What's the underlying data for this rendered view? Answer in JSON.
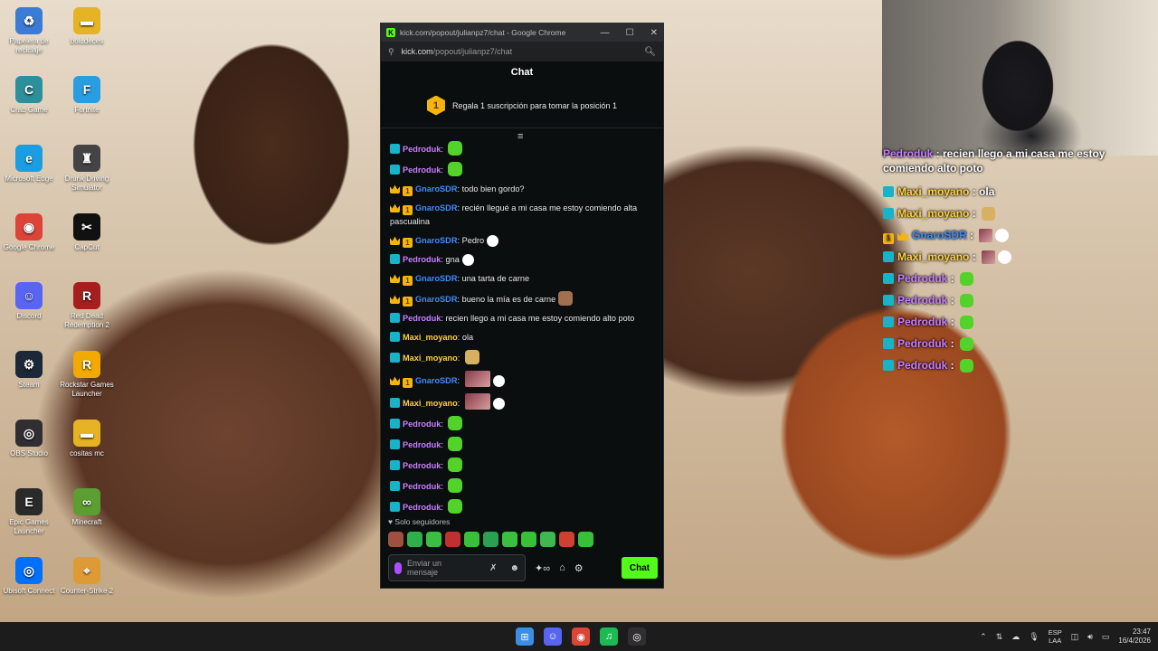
{
  "desktop_icons": [
    {
      "label": "Papelera de reciclaje",
      "icon": "recycle-bin-icon",
      "color": "#3a7bd5",
      "glyph": "♻"
    },
    {
      "label": "boludeces",
      "icon": "folder-icon",
      "color": "#e6b325",
      "glyph": "▬"
    },
    {
      "label": "Crab Game",
      "icon": "crab-game-icon",
      "color": "#2c8f9c",
      "glyph": "C"
    },
    {
      "label": "Fortnite",
      "icon": "fortnite-icon",
      "color": "#2a9de0",
      "glyph": "F"
    },
    {
      "label": "Microsoft Edge",
      "icon": "edge-icon",
      "color": "#1b9de2",
      "glyph": "e"
    },
    {
      "label": "Drunk Driving Simulator",
      "icon": "drunk-driving-icon",
      "color": "#444444",
      "glyph": "♜"
    },
    {
      "label": "Google Chrome",
      "icon": "chrome-icon",
      "color": "#db4437",
      "glyph": "◉"
    },
    {
      "label": "CapCut",
      "icon": "capcut-icon",
      "color": "#111111",
      "glyph": "✂"
    },
    {
      "label": "Discord",
      "icon": "discord-icon",
      "color": "#5865f2",
      "glyph": "☺"
    },
    {
      "label": "Red Dead Redemption 2",
      "icon": "rdr2-icon",
      "color": "#a51f1f",
      "glyph": "R"
    },
    {
      "label": "Steam",
      "icon": "steam-icon",
      "color": "#1b2838",
      "glyph": "⚙"
    },
    {
      "label": "Rockstar Games Launcher",
      "icon": "rockstar-icon",
      "color": "#f2a900",
      "glyph": "R"
    },
    {
      "label": "OBS Studio",
      "icon": "obs-icon",
      "color": "#302e31",
      "glyph": "◎"
    },
    {
      "label": "cositas mc",
      "icon": "folder-icon",
      "color": "#e6b325",
      "glyph": "▬"
    },
    {
      "label": "Epic Games Launcher",
      "icon": "epic-games-icon",
      "color": "#2a2a2a",
      "glyph": "E"
    },
    {
      "label": "Minecraft",
      "icon": "minecraft-icon",
      "color": "#5c9e31",
      "glyph": "∞"
    },
    {
      "label": "Ubisoft Connect",
      "icon": "ubisoft-icon",
      "color": "#0070ff",
      "glyph": "◎"
    },
    {
      "label": "Counter-Strike 2",
      "icon": "cs2-icon",
      "color": "#de9b35",
      "glyph": "⌖"
    }
  ],
  "window": {
    "title": "kick.com/popout/julianpz7/chat - Google Chrome",
    "url_domain": "kick.com",
    "url_path": "/popout/julianpz7/chat",
    "minimize": "—",
    "maximize": "☐",
    "close": "✕"
  },
  "chat": {
    "header": "Chat",
    "sub_banner_number": "1",
    "sub_banner_text": "Regala 1 suscripción para tomar la posición 1",
    "followers_only": "Solo seguidores",
    "input_placeholder": "Enviar un mensaje",
    "send_label": "Chat",
    "messages": [
      {
        "user": "Pedroduk",
        "cls": "u-ped",
        "badges": [
          "sub"
        ],
        "text": "",
        "emotes": [
          "green"
        ]
      },
      {
        "user": "Pedroduk",
        "cls": "u-ped",
        "badges": [
          "sub"
        ],
        "text": "",
        "emotes": [
          "green"
        ]
      },
      {
        "user": "GnaroSDR",
        "cls": "u-gna",
        "badges": [
          "crown",
          "gift"
        ],
        "text": "todo bien gordo?",
        "emotes": []
      },
      {
        "user": "GnaroSDR",
        "cls": "u-gna",
        "badges": [
          "crown",
          "gift"
        ],
        "text": "recién llegué a mi casa me estoy comiendo alta pascualina",
        "emotes": []
      },
      {
        "user": "GnaroSDR",
        "cls": "u-gna",
        "badges": [
          "crown",
          "gift"
        ],
        "text": "Pedro",
        "emotes": [
          "cat"
        ]
      },
      {
        "user": "Pedroduk",
        "cls": "u-ped",
        "badges": [
          "sub"
        ],
        "text": "gna",
        "emotes": [
          "cat"
        ]
      },
      {
        "user": "GnaroSDR",
        "cls": "u-gna",
        "badges": [
          "crown",
          "gift"
        ],
        "text": "una tarta de carne",
        "emotes": []
      },
      {
        "user": "GnaroSDR",
        "cls": "u-gna",
        "badges": [
          "crown",
          "gift"
        ],
        "text": "bueno la mía es de carne",
        "emotes": [
          "face"
        ]
      },
      {
        "user": "Pedroduk",
        "cls": "u-ped",
        "badges": [
          "sub"
        ],
        "text": "recien llego a mi casa me estoy comiendo alto poto",
        "emotes": []
      },
      {
        "user": "Maxi_moyano",
        "cls": "u-max",
        "badges": [
          "sub"
        ],
        "text": "ola",
        "emotes": []
      },
      {
        "user": "Maxi_moyano",
        "cls": "u-max",
        "badges": [
          "sub"
        ],
        "text": "",
        "emotes": [
          "dog"
        ]
      },
      {
        "user": "GnaroSDR",
        "cls": "u-gna",
        "badges": [
          "crown",
          "gift"
        ],
        "text": "",
        "emotes": [
          "img",
          "cat"
        ]
      },
      {
        "user": "Maxi_moyano",
        "cls": "u-max",
        "badges": [
          "sub"
        ],
        "text": "",
        "emotes": [
          "img",
          "cat"
        ]
      },
      {
        "user": "Pedroduk",
        "cls": "u-ped",
        "badges": [
          "sub"
        ],
        "text": "",
        "emotes": [
          "green"
        ]
      },
      {
        "user": "Pedroduk",
        "cls": "u-ped",
        "badges": [
          "sub"
        ],
        "text": "",
        "emotes": [
          "green"
        ]
      },
      {
        "user": "Pedroduk",
        "cls": "u-ped",
        "badges": [
          "sub"
        ],
        "text": "",
        "emotes": [
          "green"
        ]
      },
      {
        "user": "Pedroduk",
        "cls": "u-ped",
        "badges": [
          "sub"
        ],
        "text": "",
        "emotes": [
          "green"
        ]
      },
      {
        "user": "Pedroduk",
        "cls": "u-ped",
        "badges": [
          "sub"
        ],
        "text": "",
        "emotes": [
          "green"
        ]
      }
    ],
    "quick_emote_colors": [
      "#a05040",
      "#2fb04a",
      "#3ac040",
      "#c03030",
      "#38c038",
      "#2aa050",
      "#3ac040",
      "#38c038",
      "#40b850",
      "#d04030",
      "#38c038"
    ]
  },
  "overlay": {
    "first": {
      "user": "Pedroduk",
      "text": "recien llego a mi casa me estoy comiendo alto poto"
    },
    "lines": [
      {
        "user": "Maxi_moyano",
        "cls": "u-max",
        "badges": [
          "sub"
        ],
        "text": "ola",
        "emotes": []
      },
      {
        "user": "Maxi_moyano",
        "cls": "u-max",
        "badges": [
          "sub"
        ],
        "text": "",
        "emotes": [
          "dog"
        ]
      },
      {
        "user": "GnaroSDR",
        "cls": "u-gna",
        "badges": [
          "gift",
          "crown"
        ],
        "text": "",
        "emotes": [
          "img",
          "cat"
        ]
      },
      {
        "user": "Maxi_moyano",
        "cls": "u-max",
        "badges": [
          "sub"
        ],
        "text": "",
        "emotes": [
          "img",
          "cat"
        ]
      },
      {
        "user": "Pedroduk",
        "cls": "u-ped",
        "badges": [
          "sub"
        ],
        "text": "",
        "emotes": [
          "green"
        ]
      },
      {
        "user": "Pedroduk",
        "cls": "u-ped",
        "badges": [
          "sub"
        ],
        "text": "",
        "emotes": [
          "green"
        ]
      },
      {
        "user": "Pedroduk",
        "cls": "u-ped",
        "badges": [
          "sub"
        ],
        "text": "",
        "emotes": [
          "green"
        ]
      },
      {
        "user": "Pedroduk",
        "cls": "u-ped",
        "badges": [
          "sub"
        ],
        "text": "",
        "emotes": [
          "green"
        ]
      },
      {
        "user": "Pedroduk",
        "cls": "u-ped",
        "badges": [
          "sub"
        ],
        "text": "",
        "emotes": [
          "green"
        ]
      }
    ]
  },
  "taskbar": {
    "apps": [
      {
        "name": "start-button",
        "glyph": "⊞",
        "color": "#3a8ee6"
      },
      {
        "name": "discord-taskbar",
        "glyph": "☺",
        "color": "#5865f2"
      },
      {
        "name": "chrome-taskbar",
        "glyph": "◉",
        "color": "#db4437"
      },
      {
        "name": "spotify-taskbar",
        "glyph": "♫",
        "color": "#1db954"
      },
      {
        "name": "obs-taskbar",
        "glyph": "◎",
        "color": "#302e31"
      }
    ],
    "lang_top": "ESP",
    "lang_bottom": "LAA",
    "time": "23:47",
    "date": "16/4/2026"
  }
}
